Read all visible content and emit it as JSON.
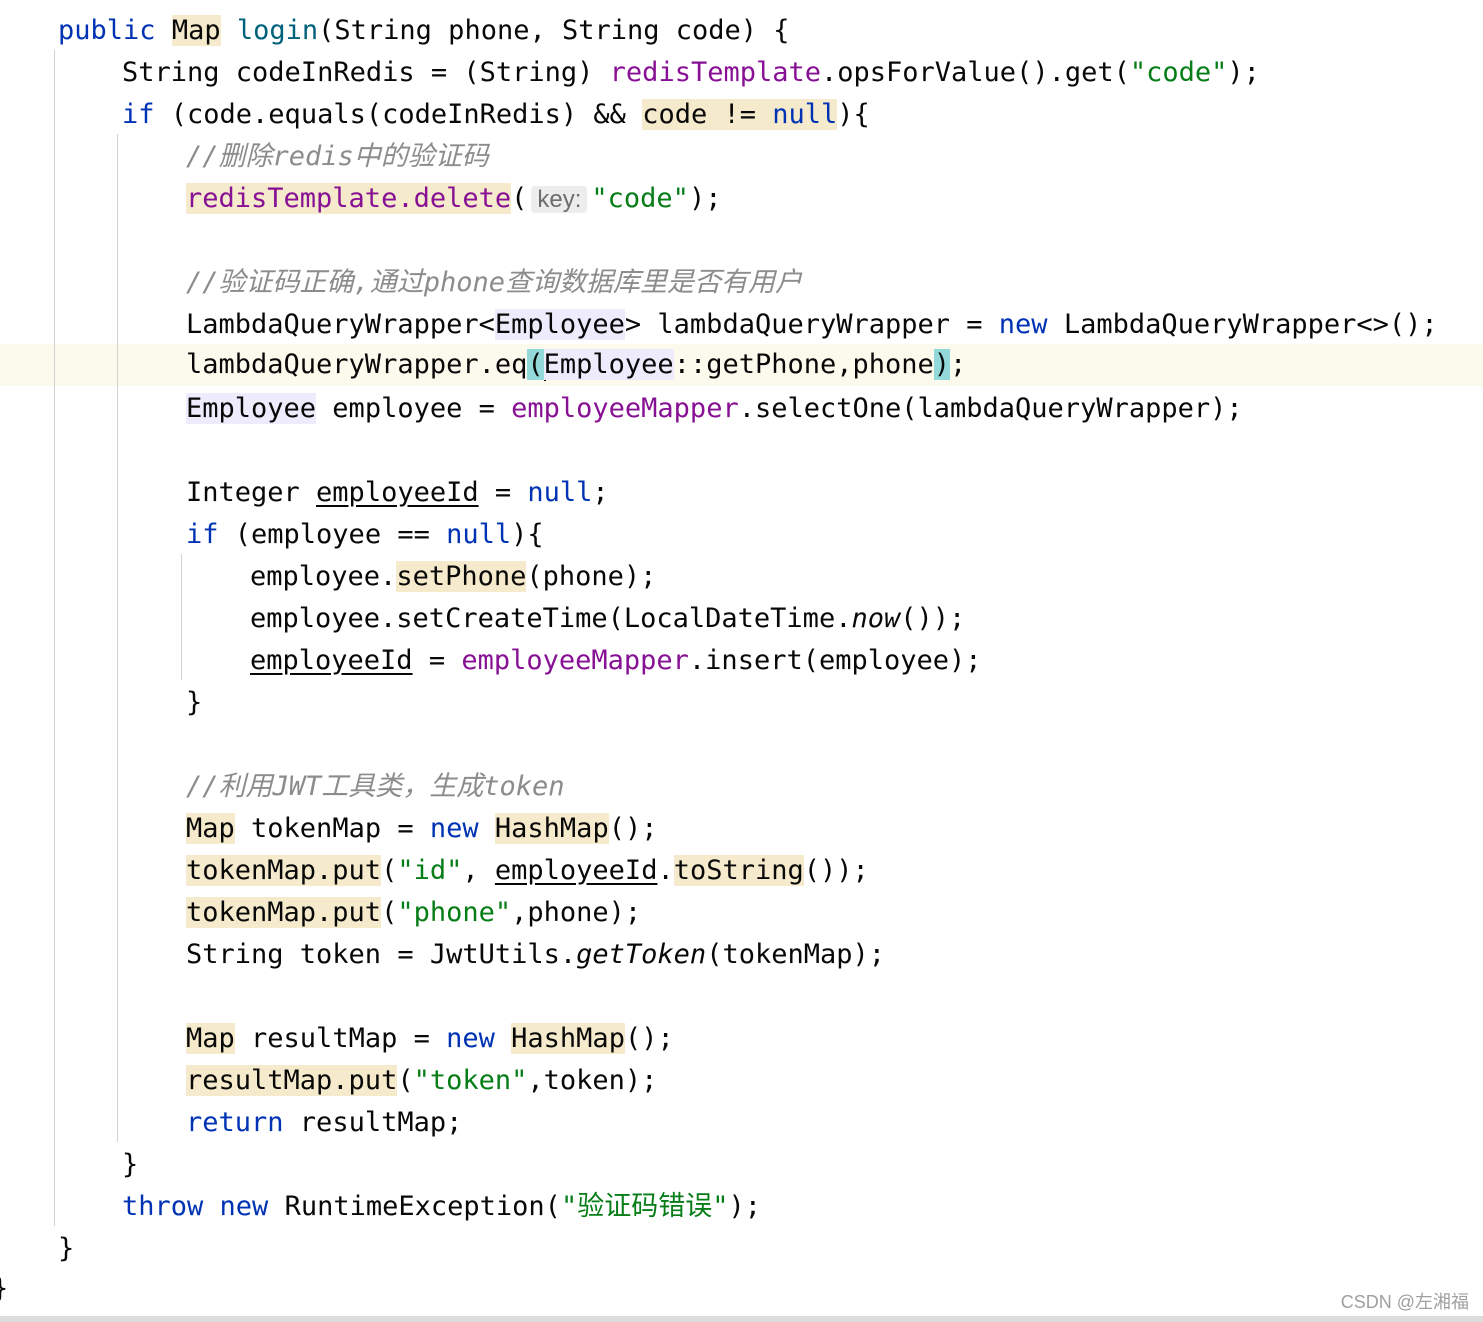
{
  "code": {
    "l01": {
      "kw_public": "public",
      "type_map": "Map",
      "method": "login",
      "params": "(String phone, String code) {"
    },
    "l02": {
      "text1": "String codeInRedis = (String) ",
      "field": "redisTemplate",
      "text2": ".opsForValue().get(",
      "str": "\"code\"",
      "text3": ");"
    },
    "l03": {
      "kw_if": "if",
      "text1": " (code.equals(codeInRedis) && ",
      "hl_code": "code != ",
      "kw_null": "null",
      "text2": "){"
    },
    "l04": {
      "comment": "//删除redis中的验证码"
    },
    "l05": {
      "hl_call": "redisTemplate.delete",
      "paren": "(",
      "hint": "key:",
      "str": "\"code\"",
      "text2": ");"
    },
    "l06": {
      "comment": "//验证码正确,通过phone查询数据库里是否有用户"
    },
    "l07": {
      "text1": "LambdaQueryWrapper<",
      "type": "Employee",
      "text2": "> lambdaQueryWrapper = ",
      "kw_new": "new",
      "text3": " LambdaQueryWrapper<>();"
    },
    "l08": {
      "text1": "lambdaQueryWrapper.eq",
      "paren_open": "(",
      "type": "Employee",
      "text2": "::getPhone,phone",
      "paren_close": ")",
      "text3": ";"
    },
    "l09": {
      "type": "Employee",
      "text1": " employee = ",
      "field": "employeeMapper",
      "text2": ".selectOne(lambdaQueryWrapper);"
    },
    "l10": {
      "text1": "Integer ",
      "var": "employeeId",
      "text2": " = ",
      "kw_null": "null",
      "text3": ";"
    },
    "l11": {
      "kw_if": "if",
      "text1": " (employee == ",
      "kw_null": "null",
      "text2": "){"
    },
    "l12": {
      "text1": "employee.",
      "hl_method": "setPhone",
      "text2": "(phone);"
    },
    "l13": {
      "text1": "employee.setCreateTime(LocalDateTime.",
      "it_method": "now",
      "text2": "());"
    },
    "l14": {
      "var": "employeeId",
      "text1": " = ",
      "field": "employeeMapper",
      "text2": ".insert(employee);"
    },
    "l15": {
      "text1": "}"
    },
    "l16": {
      "comment": "//利用JWT工具类，生成token"
    },
    "l17": {
      "type": "Map",
      "text1": " tokenMap = ",
      "kw_new": "new",
      "sp": " ",
      "hl_cls": "HashMap",
      "text2": "();"
    },
    "l18": {
      "hl_put": "tokenMap.put",
      "text1": "(",
      "str": "\"id\"",
      "text2": ", ",
      "var": "employeeId",
      "dot": ".",
      "hl_method": "toString",
      "text3": "());"
    },
    "l19": {
      "hl_put": "tokenMap.put",
      "text1": "(",
      "str": "\"phone\"",
      "text2": ",phone);"
    },
    "l20": {
      "text1": "String token = JwtUtils.",
      "it_method": "getToken",
      "text2": "(tokenMap);"
    },
    "l21": {
      "type": "Map",
      "text1": " resultMap = ",
      "kw_new": "new",
      "sp": " ",
      "hl_cls": "HashMap",
      "text2": "();"
    },
    "l22": {
      "hl_put": "resultMap.put",
      "text1": "(",
      "str": "\"token\"",
      "text2": ",token);"
    },
    "l23": {
      "kw_return": "return",
      "text1": " resultMap;"
    },
    "l24": {
      "text1": "}"
    },
    "l25": {
      "kw_throw": "throw",
      "sp": " ",
      "kw_new": "new",
      "text1": " RuntimeException(",
      "str": "\"验证码错误\"",
      "text2": ");"
    },
    "l26": {
      "text1": "}"
    },
    "l27": {
      "text1": "}"
    }
  },
  "watermark": "CSDN @左湘福",
  "colors": {
    "keyword": "#0033b3",
    "string": "#067d17",
    "field": "#871094",
    "comment": "#8c8c8c",
    "usage_highlight": "#f5eacb",
    "type_highlight": "#edebfc",
    "brace_match": "#93d9d9",
    "current_line": "#fcfaed"
  }
}
